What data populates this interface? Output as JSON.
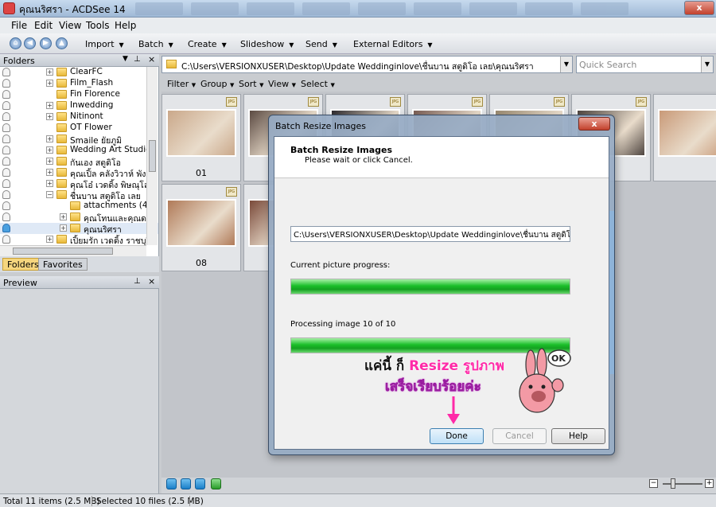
{
  "window": {
    "title": "คุณนริศรา - ACDSee 14",
    "close_label": "x"
  },
  "menu": [
    "File",
    "Edit",
    "View",
    "Tools",
    "Help"
  ],
  "toolbar": {
    "nav_icons": [
      "home-icon",
      "back-icon",
      "forward-icon",
      "up-icon"
    ],
    "items": [
      "Import",
      "Batch",
      "Create",
      "Slideshow",
      "Send",
      "External Editors"
    ]
  },
  "folders_panel": {
    "title": "Folders",
    "items": [
      {
        "label": "ClearFC",
        "expander": "+"
      },
      {
        "label": "Film_Flash",
        "expander": "+"
      },
      {
        "label": "Fin Florence",
        "expander": ""
      },
      {
        "label": "Inwedding",
        "expander": "+"
      },
      {
        "label": "Nitinont",
        "expander": "+"
      },
      {
        "label": "OT Flower",
        "expander": ""
      },
      {
        "label": "Smaile ยัยภูมิ",
        "expander": "+"
      },
      {
        "label": "Wedding Art Studio",
        "expander": "+"
      },
      {
        "label": "กันเอง สตูดิโอ",
        "expander": "+"
      },
      {
        "label": "คุณเปิ้ล คลังวิวาห์ พังงา",
        "expander": "+"
      },
      {
        "label": "คุณโอ๋ เวดดิ้ง พิษณุโลก",
        "expander": "+"
      },
      {
        "label": "ชื่นบาน สตูดิโอ เลย",
        "expander": "−"
      },
      {
        "label": "attachments (4)",
        "expander": ""
      },
      {
        "label": "คุณโทนและคุณดาร",
        "expander": "+"
      },
      {
        "label": "คุณนริศรา",
        "expander": "+"
      },
      {
        "label": "เปิ้ยมรัก เวดดิ้ง ราชบุรี",
        "expander": "+"
      }
    ],
    "tabs": [
      "Folders",
      "Favorites"
    ]
  },
  "preview_panel": {
    "title": "Preview"
  },
  "path_bar": {
    "path": "C:\\Users\\VERSIONXUSER\\Desktop\\Update Weddinginlove\\ชื่นบาน สตูดิโอ เลย\\คุณนริศรา"
  },
  "quick_search": {
    "placeholder": "Quick Search"
  },
  "filter_bar": [
    "Filter",
    "Group",
    "Sort",
    "View",
    "Select"
  ],
  "thumbnails": [
    {
      "name": "01",
      "badge": "JPG"
    },
    {
      "name": "",
      "badge": "JPG"
    },
    {
      "name": "",
      "badge": "JPG"
    },
    {
      "name": "",
      "badge": "JPG"
    },
    {
      "name": "",
      "badge": "JPG"
    },
    {
      "name": "",
      "badge": "JPG"
    },
    {
      "name": "",
      "badge": "JPG"
    },
    {
      "name": "08",
      "badge": "JPG"
    },
    {
      "name": "",
      "badge": "JPG"
    }
  ],
  "status_bar": {
    "total": "Total 11 items  (2.5 MB)",
    "selected": "Selected 10 files (2.5 MB)"
  },
  "dialog": {
    "title": "Batch Resize Images",
    "header_title": "Batch Resize Images",
    "header_subtitle": "Please wait or click Cancel.",
    "current_path": "C:\\Users\\VERSIONXUSER\\Desktop\\Update Weddinginlove\\ชื่นบาน สตูดิโอ เลย\\คุณนริศรา\\",
    "picture_progress_label": "Current picture progress:",
    "picture_progress": 1.0,
    "processing_label": "Processing image  10 of 10",
    "overall_progress": 1.0,
    "buttons": {
      "done": "Done",
      "cancel": "Cancel",
      "help": "Help"
    }
  },
  "overlay": {
    "line1_black": "แค่นี้ ก็",
    "line1_pink": "Resize",
    "line1_black2": "รูปภาพ",
    "line2": "เสร็จเรียบร้อยค่ะ",
    "sticker_text": "OK",
    "arrow_color": "#ff2aa8"
  }
}
